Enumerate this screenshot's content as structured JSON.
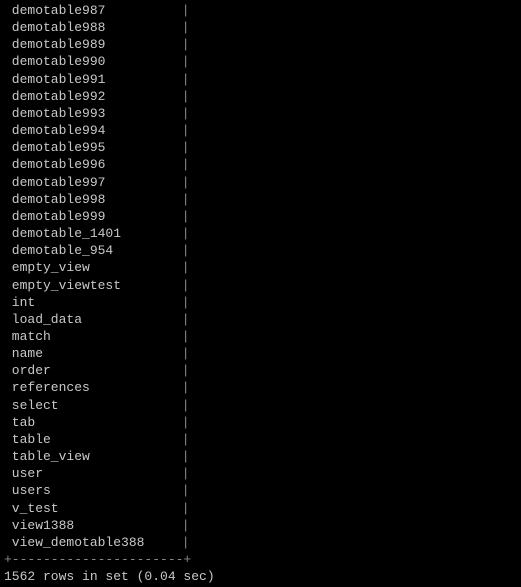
{
  "terminal": {
    "rows": [
      {
        "name": "demotable987",
        "pipe": "|"
      },
      {
        "name": "demotable988",
        "pipe": "|"
      },
      {
        "name": "demotable989",
        "pipe": "|"
      },
      {
        "name": "demotable990",
        "pipe": "|"
      },
      {
        "name": "demotable991",
        "pipe": "|"
      },
      {
        "name": "demotable992",
        "pipe": "|"
      },
      {
        "name": "demotable993",
        "pipe": "|"
      },
      {
        "name": "demotable994",
        "pipe": "|"
      },
      {
        "name": "demotable995",
        "pipe": "|"
      },
      {
        "name": "demotable996",
        "pipe": "|"
      },
      {
        "name": "demotable997",
        "pipe": "|"
      },
      {
        "name": "demotable998",
        "pipe": "|"
      },
      {
        "name": "demotable999",
        "pipe": "|"
      },
      {
        "name": "demotable_1401",
        "pipe": "|"
      },
      {
        "name": "demotable_954",
        "pipe": "|"
      },
      {
        "name": "empty_view",
        "pipe": "|"
      },
      {
        "name": "empty_viewtest",
        "pipe": "|"
      },
      {
        "name": "int",
        "pipe": "|"
      },
      {
        "name": "load_data",
        "pipe": "|"
      },
      {
        "name": "match",
        "pipe": "|"
      },
      {
        "name": "name",
        "pipe": "|"
      },
      {
        "name": "order",
        "pipe": "|"
      },
      {
        "name": "references",
        "pipe": "|"
      },
      {
        "name": "select",
        "pipe": "|"
      },
      {
        "name": "tab",
        "pipe": "|"
      },
      {
        "name": "table",
        "pipe": "|"
      },
      {
        "name": "table_view",
        "pipe": "|"
      },
      {
        "name": "user",
        "pipe": "|"
      },
      {
        "name": "users",
        "pipe": "|"
      },
      {
        "name": "v_test",
        "pipe": "|"
      },
      {
        "name": "view1388",
        "pipe": "|"
      },
      {
        "name": "view_demotable388",
        "pipe": "|"
      }
    ],
    "divider": "+----------------------+",
    "summary": "1562 rows in set (0.04 sec)"
  }
}
